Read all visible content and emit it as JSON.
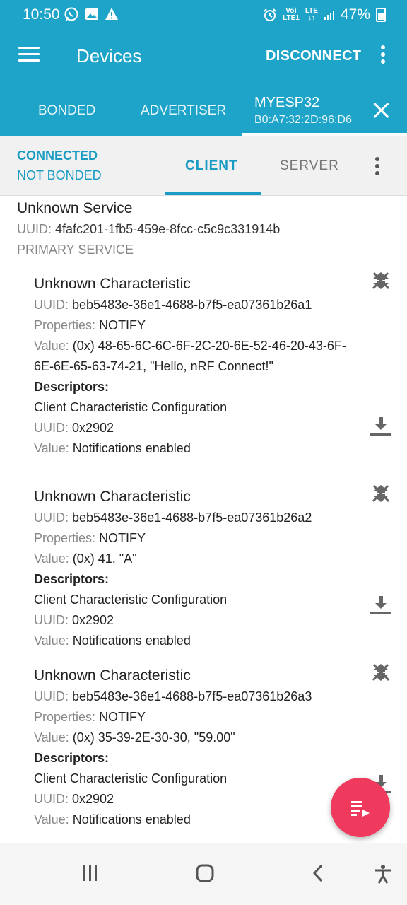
{
  "status_bar": {
    "time": "10:50",
    "net_top": "Vo)",
    "net_bottom": "LTE1",
    "lte_top": "LTE",
    "lte_bottom": "↓↑",
    "battery": "47%"
  },
  "app_bar": {
    "title": "Devices",
    "action": "DISCONNECT"
  },
  "tabs": [
    {
      "label": "BONDED"
    },
    {
      "label": "ADVERTISER"
    },
    {
      "label": "MYESP32",
      "subtitle": "B0:A7:32:2D:96:D6",
      "active": true
    }
  ],
  "connection": {
    "state": "CONNECTED",
    "bond": "NOT BONDED",
    "client_tab": "CLIENT",
    "server_tab": "SERVER"
  },
  "service": {
    "title": "Unknown Service",
    "uuid_label": "UUID:",
    "uuid": "4fafc201-1fb5-459e-8fcc-c5c9c331914b",
    "type": "PRIMARY SERVICE"
  },
  "labels": {
    "uuid": "UUID:",
    "properties": "Properties:",
    "value": "Value:",
    "descriptors": "Descriptors:"
  },
  "characteristics": [
    {
      "title": "Unknown Characteristic",
      "uuid": "beb5483e-36e1-4688-b7f5-ea07361b26a1",
      "properties": "NOTIFY",
      "value": "(0x) 48-65-6C-6C-6F-2C-20-6E-52-46-20-43-6F-6E-6E-65-63-74-21, \"Hello, nRF Connect!\"",
      "descriptor_name": "Client Characteristic Configuration",
      "descriptor_uuid": "0x2902",
      "descriptor_value": "Notifications enabled"
    },
    {
      "title": "Unknown Characteristic",
      "uuid": "beb5483e-36e1-4688-b7f5-ea07361b26a2",
      "properties": "NOTIFY",
      "value": "(0x) 41, \"A\"",
      "descriptor_name": "Client Characteristic Configuration",
      "descriptor_uuid": "0x2902",
      "descriptor_value": "Notifications enabled"
    },
    {
      "title": "Unknown Characteristic",
      "uuid": "beb5483e-36e1-4688-b7f5-ea07361b26a3",
      "properties": "NOTIFY",
      "value": "(0x) 35-39-2E-30-30, \"59.00\"",
      "descriptor_name": "Client Characteristic Configuration",
      "descriptor_uuid": "0x2902",
      "descriptor_value": "Notifications enabled"
    }
  ],
  "colors": {
    "primary": "#1ea4c9",
    "accent": "#1a9bc3",
    "fab": "#ef3a5d"
  }
}
